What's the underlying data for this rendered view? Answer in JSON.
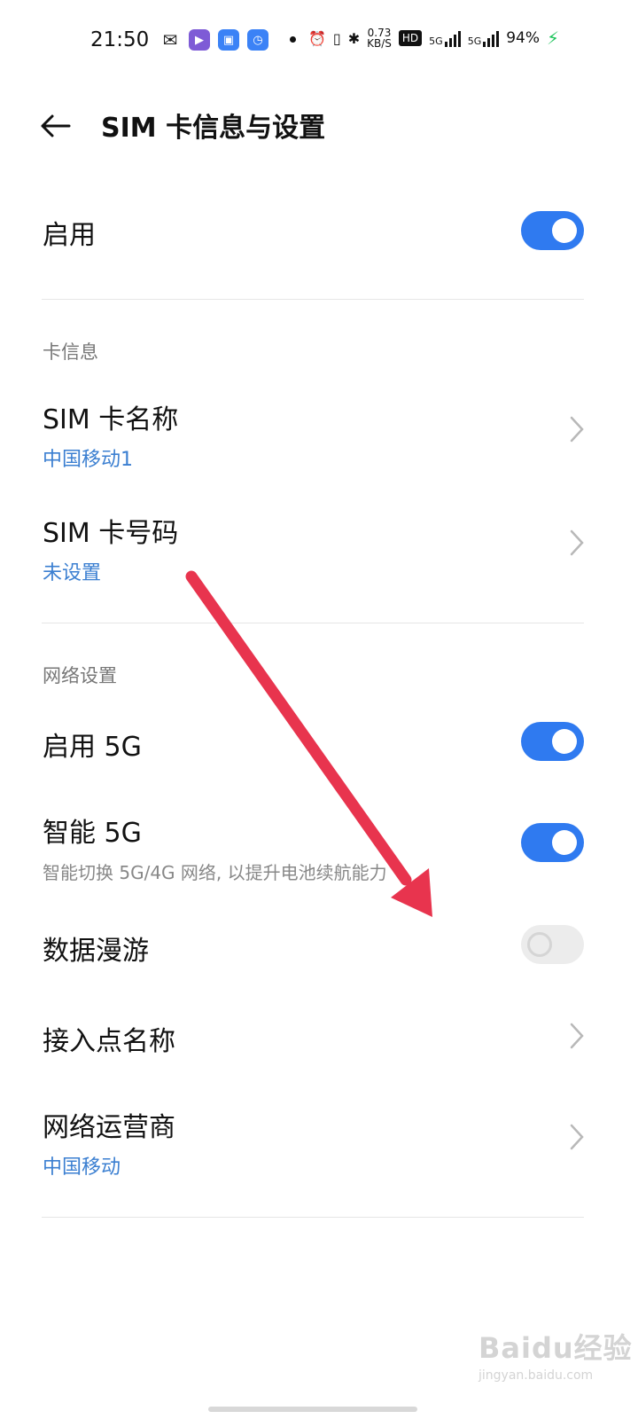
{
  "status_bar": {
    "time": "21:50",
    "speed_value": "0.73",
    "speed_unit": "KB/S",
    "hd_badge": "HD",
    "network1": "5G",
    "network2": "5G",
    "battery": "94%"
  },
  "header": {
    "title": "SIM 卡信息与设置"
  },
  "enable": {
    "label": "启用",
    "state": "on"
  },
  "card_info": {
    "section_title": "卡信息",
    "sim_name": {
      "label": "SIM 卡名称",
      "value": "中国移动1"
    },
    "sim_number": {
      "label": "SIM 卡号码",
      "value": "未设置"
    }
  },
  "network_settings": {
    "section_title": "网络设置",
    "enable_5g": {
      "label": "启用 5G",
      "state": "on"
    },
    "smart_5g": {
      "label": "智能 5G",
      "description": "智能切换 5G/4G 网络, 以提升电池续航能力",
      "state": "on"
    },
    "data_roaming": {
      "label": "数据漫游",
      "state": "off"
    },
    "apn": {
      "label": "接入点名称"
    },
    "operator": {
      "label": "网络运营商",
      "value": "中国移动"
    }
  },
  "watermark": {
    "main": "Baidu经验",
    "sub": "jingyan.baidu.com"
  },
  "colors": {
    "accent": "#2f7af0",
    "link_blue": "#3b7fd1",
    "annotation_arrow": "#e8344e"
  }
}
